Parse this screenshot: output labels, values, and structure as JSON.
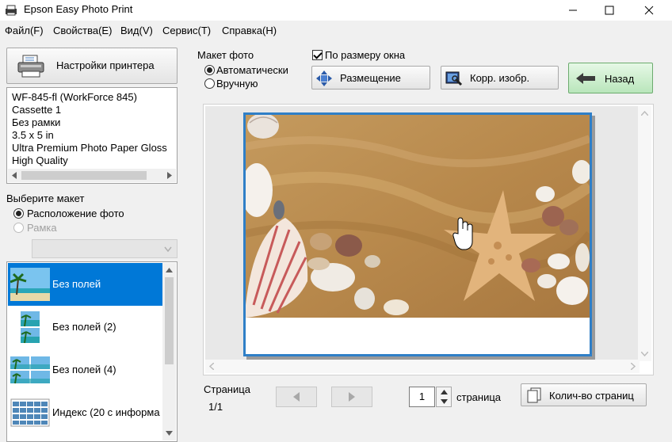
{
  "window": {
    "title": "Epson Easy Photo Print"
  },
  "menu": [
    {
      "label": "Файл(F)"
    },
    {
      "label": "Свойства(E)"
    },
    {
      "label": "Вид(V)"
    },
    {
      "label": "Сервис(T)"
    },
    {
      "label": "Справка(H)"
    }
  ],
  "printer": {
    "settings_button": "Настройки принтера",
    "info": [
      "WF-845-fl (WorkForce 845)",
      "Cassette 1",
      "Без рамки",
      "3.5 x 5 in",
      "Ultra Premium Photo Paper Gloss",
      "High Quality"
    ]
  },
  "layout": {
    "heading": "Выберите макет",
    "options": [
      {
        "label": "Расположение фото",
        "checked": true,
        "enabled": true
      },
      {
        "label": "Рамка",
        "checked": false,
        "enabled": false
      }
    ],
    "items": [
      {
        "label": "Без полей",
        "selected": true
      },
      {
        "label": "Без полей (2)",
        "selected": false
      },
      {
        "label": "Без полей (4)",
        "selected": false
      },
      {
        "label": "Индекс (20 с информа",
        "selected": false
      }
    ]
  },
  "photo_layout": {
    "heading": "Макет фото",
    "options": [
      {
        "label": "Автоматически",
        "checked": true
      },
      {
        "label": "Вручную",
        "checked": false
      }
    ],
    "fit_window": {
      "label": "По размеру окна",
      "checked": true
    }
  },
  "toolbar": {
    "placement": "Размещение",
    "correct": "Корр. изобр.",
    "back": "Назад"
  },
  "pager": {
    "heading": "Страница",
    "position": "1/1",
    "copies": "1",
    "copies_label": "страница",
    "pages_button": "Колич-во страниц"
  },
  "colors": {
    "selection": "#0078d7",
    "frame": "#2f7fc7",
    "back_button": "#c8f0c8"
  }
}
